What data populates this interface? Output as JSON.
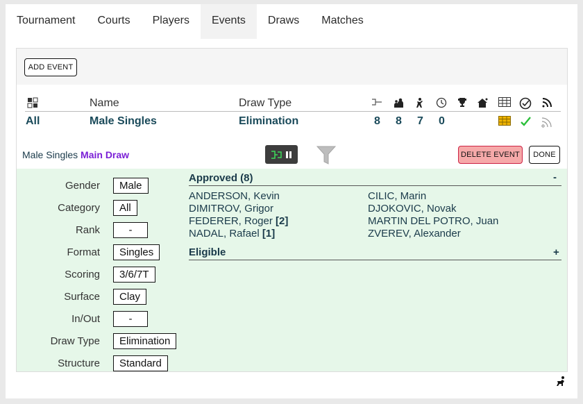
{
  "tabs": [
    "Tournament",
    "Courts",
    "Players",
    "Events",
    "Draws",
    "Matches"
  ],
  "active_tab": 3,
  "toolbar": {
    "add_event": "ADD EVENT"
  },
  "events": {
    "headers": {
      "name": "Name",
      "draw_type": "Draw Type"
    },
    "icons": [
      "grid-icon",
      "bracket-icon",
      "players-icon",
      "umpire-icon",
      "clock-icon",
      "trophy-icon",
      "home-icon",
      "table-icon",
      "check-circle-icon",
      "rss-icon"
    ],
    "row": {
      "category": "All",
      "name": "Male Singles",
      "draw_type": "Elimination",
      "counts": [
        "8",
        "8",
        "7",
        "0"
      ]
    }
  },
  "selected": {
    "event": "Male Singles",
    "draw": "Main Draw",
    "delete": "DELETE EVENT",
    "done": "DONE"
  },
  "properties": [
    {
      "label": "Gender",
      "value": "Male"
    },
    {
      "label": "Category",
      "value": "All"
    },
    {
      "label": "Rank",
      "value": "-"
    },
    {
      "label": "Format",
      "value": "Singles"
    },
    {
      "label": "Scoring",
      "value": "3/6/7T"
    },
    {
      "label": "Surface",
      "value": "Clay"
    },
    {
      "label": "In/Out",
      "value": "-"
    },
    {
      "label": "Draw Type",
      "value": "Elimination"
    },
    {
      "label": "Structure",
      "value": "Standard"
    }
  ],
  "approved": {
    "title": "Approved (8)",
    "toggle": "-",
    "players": [
      {
        "name": "ANDERSON, Kevin",
        "seed": ""
      },
      {
        "name": "CILIC, Marin",
        "seed": ""
      },
      {
        "name": "DIMITROV, Grigor",
        "seed": ""
      },
      {
        "name": "DJOKOVIC, Novak",
        "seed": ""
      },
      {
        "name": "FEDERER, Roger",
        "seed": "[2]"
      },
      {
        "name": "MARTIN DEL POTRO, Juan",
        "seed": ""
      },
      {
        "name": "NADAL, Rafael",
        "seed": "[1]"
      },
      {
        "name": "ZVEREV, Alexander",
        "seed": ""
      }
    ]
  },
  "eligible": {
    "title": "Eligible",
    "toggle": "+"
  },
  "colors": {
    "accent_draw": "#7a1fd6",
    "detail_bg": "#e6f7e9",
    "delete_bg": "#f6a9a9",
    "count_color": "#1a4a5a"
  }
}
